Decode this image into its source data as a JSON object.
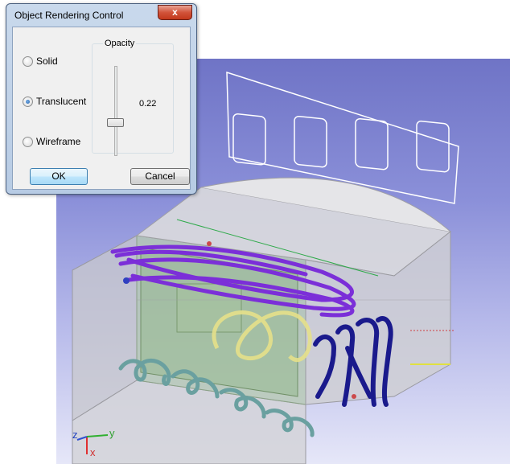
{
  "dialog": {
    "title": "Object Rendering Control",
    "close_glyph": "x",
    "render_modes": [
      {
        "label": "Solid",
        "checked": false
      },
      {
        "label": "Translucent",
        "checked": true
      },
      {
        "label": "Wireframe",
        "checked": false
      }
    ],
    "opacity": {
      "group_label": "Opacity",
      "value_text": "0.22",
      "value": 0.22
    },
    "ok_label": "OK",
    "cancel_label": "Cancel"
  },
  "viewport": {
    "axes": {
      "z_label": "z",
      "y_label": "y",
      "x_label": "x"
    },
    "colors": {
      "background_top": "#6f74c6",
      "background_bottom": "#e6e7f8",
      "purple_annotation": "#7b2fd8",
      "navy_annotation": "#1a1a8c",
      "teal_annotation": "#6aa0a0",
      "yellow_annotation": "#e6e08a",
      "green_tint": "#9fc09a"
    }
  }
}
